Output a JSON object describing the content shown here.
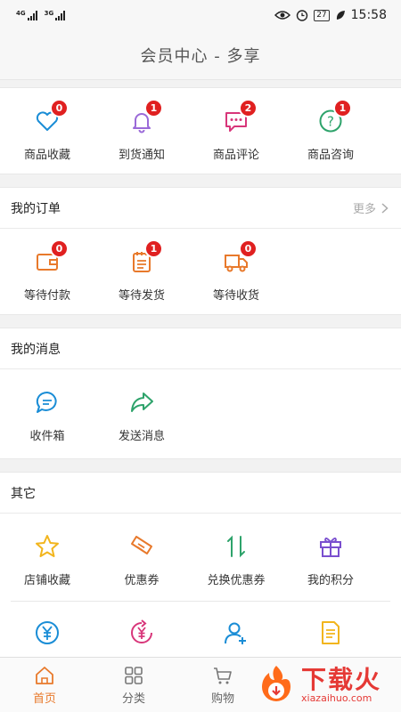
{
  "status_bar": {
    "network_1": "4G",
    "network_2": "3G",
    "battery": "27",
    "time": "15:58"
  },
  "header": {
    "title": "会员中心 - 多享"
  },
  "quick": [
    {
      "label": "商品收藏",
      "badge": "0",
      "icon": "heart-icon"
    },
    {
      "label": "到货通知",
      "badge": "1",
      "icon": "bell-icon"
    },
    {
      "label": "商品评论",
      "badge": "2",
      "icon": "comment-icon"
    },
    {
      "label": "商品咨询",
      "badge": "1",
      "icon": "question-icon"
    }
  ],
  "orders": {
    "title": "我的订单",
    "more": "更多",
    "items": [
      {
        "label": "等待付款",
        "badge": "0",
        "icon": "wallet-icon"
      },
      {
        "label": "等待发货",
        "badge": "1",
        "icon": "clipboard-icon"
      },
      {
        "label": "等待收货",
        "badge": "0",
        "icon": "truck-icon"
      }
    ]
  },
  "messages": {
    "title": "我的消息",
    "items": [
      {
        "label": "收件箱",
        "icon": "chat-bubble-icon"
      },
      {
        "label": "发送消息",
        "icon": "share-arrow-icon"
      }
    ]
  },
  "other": {
    "title": "其它",
    "items": [
      {
        "label": "店铺收藏",
        "icon": "star-icon"
      },
      {
        "label": "优惠券",
        "icon": "ticket-icon"
      },
      {
        "label": "兑换优惠券",
        "icon": "exchange-icon"
      },
      {
        "label": "我的积分",
        "icon": "gift-icon"
      }
    ],
    "row2_icons": [
      "yen-circle-icon",
      "yen-refresh-icon",
      "add-user-icon",
      "document-icon"
    ]
  },
  "tabbar": [
    {
      "label": "首页",
      "icon": "home-icon",
      "active": true
    },
    {
      "label": "分类",
      "icon": "grid-icon",
      "active": false
    },
    {
      "label": "购物",
      "icon": "cart-icon",
      "active": false
    }
  ],
  "watermark": {
    "cn": "下载火",
    "en": "xiazaihuo.com"
  },
  "colors": {
    "accent_orange": "#e8792b",
    "badge_red": "#e02020",
    "blue": "#1a8dd6",
    "purple": "#9b6ad8",
    "pink": "#d8367a",
    "green": "#2ea36b",
    "yellow": "#f2b51d"
  }
}
